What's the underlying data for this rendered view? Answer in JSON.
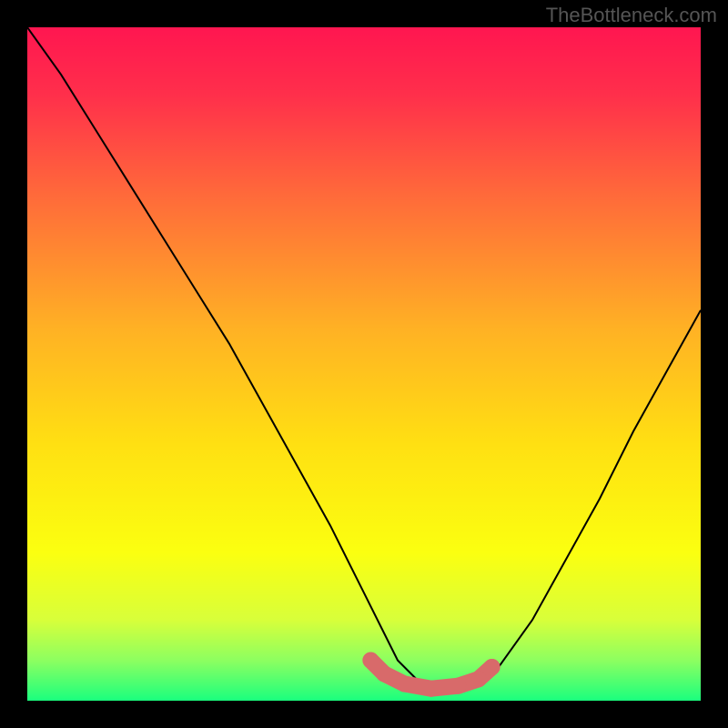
{
  "watermark": "TheBottleneck.com",
  "chart_data": {
    "type": "line",
    "title": "",
    "xlabel": "",
    "ylabel": "",
    "xlim": [
      0,
      100
    ],
    "ylim": [
      0,
      100
    ],
    "series": [
      {
        "name": "bottleneck-curve",
        "x": [
          0,
          5,
          10,
          15,
          20,
          25,
          30,
          35,
          40,
          45,
          50,
          53,
          55,
          58,
          62,
          65,
          68,
          70,
          75,
          80,
          85,
          90,
          95,
          100
        ],
        "values": [
          100,
          93,
          85,
          77,
          69,
          61,
          53,
          44,
          35,
          26,
          16,
          10,
          6,
          3,
          2,
          2,
          3,
          5,
          12,
          21,
          30,
          40,
          49,
          58
        ]
      },
      {
        "name": "optimal-band-marker",
        "x": [
          51,
          53,
          56,
          60,
          64,
          67,
          69
        ],
        "values": [
          6,
          4,
          2.5,
          1.8,
          2.2,
          3.2,
          5
        ]
      }
    ],
    "gradient_stops": [
      {
        "offset": 0.0,
        "color": "#ff1650"
      },
      {
        "offset": 0.1,
        "color": "#ff2f4b"
      },
      {
        "offset": 0.25,
        "color": "#ff6a3a"
      },
      {
        "offset": 0.45,
        "color": "#ffb224"
      },
      {
        "offset": 0.62,
        "color": "#ffe012"
      },
      {
        "offset": 0.78,
        "color": "#fbff10"
      },
      {
        "offset": 0.88,
        "color": "#d8ff3a"
      },
      {
        "offset": 0.94,
        "color": "#8dff60"
      },
      {
        "offset": 1.0,
        "color": "#1aff7e"
      }
    ],
    "curve_color": "#000000",
    "marker_color": "#d86a6a"
  }
}
